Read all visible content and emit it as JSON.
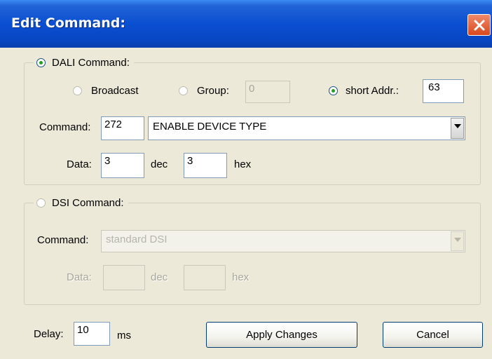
{
  "window": {
    "title": "Edit Command:"
  },
  "dali": {
    "legend": "DALI Command:",
    "selected": true,
    "broadcast_label": "Broadcast",
    "group_label": "Group:",
    "group_value": "0",
    "short_addr_label": "short Addr.:",
    "short_addr_value": "63",
    "address_mode": "short",
    "command_label": "Command:",
    "command_number": "272",
    "command_name": "ENABLE DEVICE TYPE",
    "data_label": "Data:",
    "data_dec": "3",
    "dec_label": "dec",
    "data_hex": "3",
    "hex_label": "hex"
  },
  "dsi": {
    "legend": "DSI Command:",
    "selected": false,
    "command_label": "Command:",
    "command_value": "standard DSI",
    "data_label": "Data:",
    "data_dec": "",
    "dec_label": "dec",
    "data_hex": "",
    "hex_label": "hex"
  },
  "footer": {
    "delay_label": "Delay:",
    "delay_value": "10",
    "ms_label": "ms",
    "apply_label": "Apply Changes",
    "cancel_label": "Cancel"
  },
  "icons": {
    "close": "close-icon",
    "radio_selected": "radio-selected-icon",
    "radio_unselected": "radio-unselected-icon",
    "dropdown": "chevron-down-icon"
  },
  "colors": {
    "titlebar": "#0a4fd1",
    "dialog_bg": "#ece9d8",
    "close_button": "#d8481e",
    "radio_dot": "#21a121",
    "disabled_text": "#a7a69a"
  }
}
